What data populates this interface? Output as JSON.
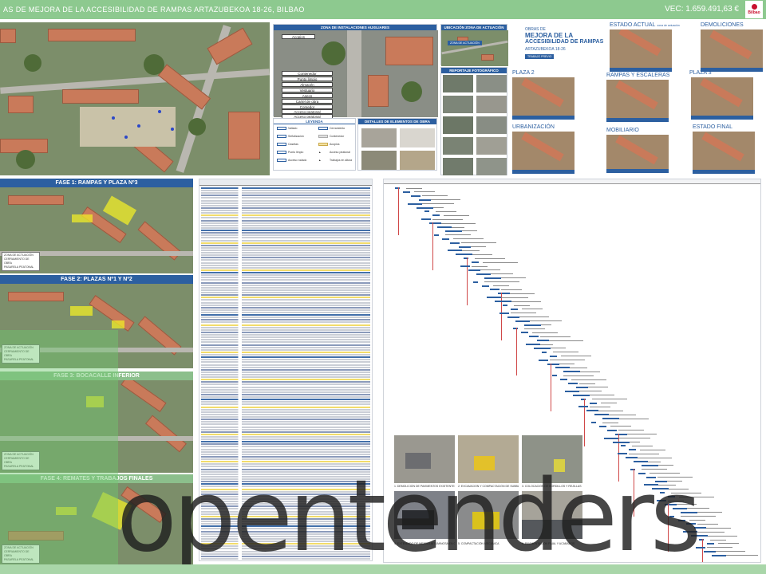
{
  "header": {
    "title": "AS DE MEJORA DE LA ACCESIBILIDAD DE RAMPAS ARTAZUBEKOA 18-26, BILBAO",
    "budget": "VEC: 1.659.491,63 €",
    "logo_text": "Bilbao"
  },
  "phases": [
    {
      "title": "FASE 1: RAMPAS Y PLAZA Nº3",
      "legend": [
        "ZONA DE ACTUACIÓN",
        "CERRAMIENTO DE OBRA",
        "PASARELA PEATONAL"
      ]
    },
    {
      "title": "FASE 2: PLAZAS Nº1 Y Nº2",
      "legend": [
        "ZONA DE ACTUACIÓN",
        "CERRAMIENTO DE OBRA",
        "PASARELA PEATONAL"
      ]
    },
    {
      "title": "FASE 3: BOCACALLE INFERIOR",
      "legend": [
        "ZONA DE ACTUACIÓN",
        "CERRAMIENTO DE OBRA",
        "PASARELA PEATONAL"
      ]
    },
    {
      "title": "FASE 4: REMATES Y TRABAJOS FINALES",
      "legend": [
        "ZONA DE ACTUACIÓN",
        "CERRAMIENTO DE OBRA",
        "PASARELA PEATONAL"
      ]
    }
  ],
  "installations": {
    "title": "ZONA DE INSTALACIONES AUXILIARES",
    "labels": [
      "Acopios",
      "Contenedor",
      "Punto limpio",
      "Almacén",
      "Vestuario",
      "Aseos",
      "Cartel de obra",
      "Comedor",
      "Acceso peatonal",
      "Acceso peatonal"
    ],
    "legend_title": "LEYENDA",
    "legend_items": [
      "Vallado",
      "Cerramiento",
      "Señalización",
      "Contenedor",
      "Casetas",
      "Acopios",
      "Punto limpio",
      "Acceso peatonal",
      "Acceso rodado",
      "Trabajos en altura"
    ],
    "details_title": "DETALLES DE ELEMENTOS DE OBRA"
  },
  "location": {
    "title": "UBICACIÓN ZONA DE ACTUACIÓN",
    "tag": "ZONA DE ACTUACIÓN",
    "photos_title": "REPORTAJE FOTOGRÁFICO"
  },
  "cover": {
    "small": "OBRAS DE",
    "title_lines": [
      "MEJORA DE LA",
      "ACCESIBILIDAD DE RAMPAS"
    ],
    "subtitle": "ARTAZUBEKOA 18-26",
    "badge": "TRABAJO PREVIO"
  },
  "stages": [
    {
      "title": "ESTADO ACTUAL",
      "note": "zona de actuación"
    },
    {
      "title": "DEMOLICIONES",
      "note": ""
    },
    {
      "title": "PLAZA 2",
      "note": ""
    },
    {
      "title": "RAMPAS Y ESCALERAS",
      "note": ""
    },
    {
      "title": "PLAZA 3",
      "note": ""
    },
    {
      "title": "URBANIZACIÓN",
      "note": ""
    },
    {
      "title": "MOBILIARIO",
      "note": ""
    },
    {
      "title": "ESTADO FINAL",
      "note": ""
    }
  ],
  "works": [
    {
      "caption": "1. DEMOLICIÓN DE PAVIMENTOS EXISTENTES"
    },
    {
      "caption": "2. EXCAVACIÓN Y COMPACTACIÓN DE SUBBASE"
    },
    {
      "caption": "3. COLOCACIÓN DE BORDILLOS Y REJILLAS"
    },
    {
      "caption": "4. EXTENDIDO DE MEZCLA BITUMINOSA EN CALIENTE"
    },
    {
      "caption": "5. COMPACTACIÓN MECÁNICA"
    },
    {
      "caption": "6. PAVIMENTACIÓN FINAL Y ACABADOS"
    }
  ],
  "watermark": "opentenders",
  "colors": {
    "header_green": "#8dc98f",
    "panel_blue": "#2c5fa0",
    "highlight_yellow": "#f0ec28",
    "brand_red": "#c8102e"
  }
}
